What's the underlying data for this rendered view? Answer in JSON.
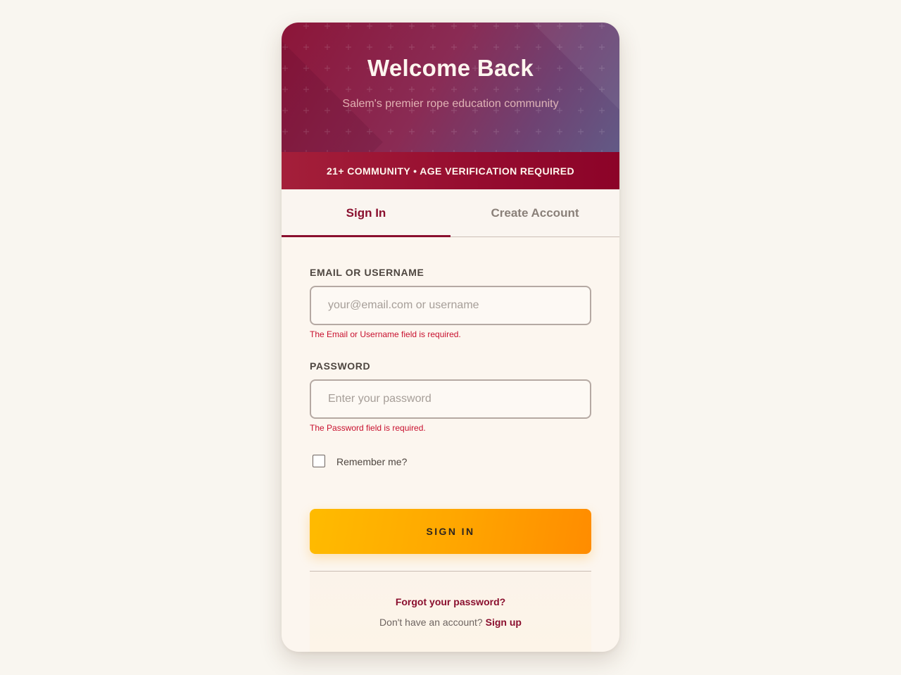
{
  "header": {
    "title": "Welcome Back",
    "subtitle": "Salem's premier rope education community"
  },
  "banner": {
    "text": "21+ COMMUNITY • AGE VERIFICATION REQUIRED"
  },
  "tabs": [
    {
      "label": "Sign In",
      "active": true
    },
    {
      "label": "Create Account",
      "active": false
    }
  ],
  "form": {
    "email": {
      "label": "EMAIL OR USERNAME",
      "placeholder": "your@email.com or username",
      "value": "",
      "error": "The Email or Username field is required."
    },
    "password": {
      "label": "PASSWORD",
      "placeholder": "Enter your password",
      "value": "",
      "error": "The Password field is required."
    },
    "remember": {
      "label": "Remember me?",
      "checked": false
    },
    "submit_label": "SIGN IN"
  },
  "footer": {
    "forgot_label": "Forgot your password?",
    "no_account_text": "Don't have an account?",
    "signup_label": "Sign up"
  },
  "colors": {
    "background": "#f9f6f0",
    "card": "#fcf6ef",
    "brand": "#8a0f2e",
    "error": "#c8102e",
    "button_start": "#ffbb00",
    "button_end": "#ff8c00"
  }
}
